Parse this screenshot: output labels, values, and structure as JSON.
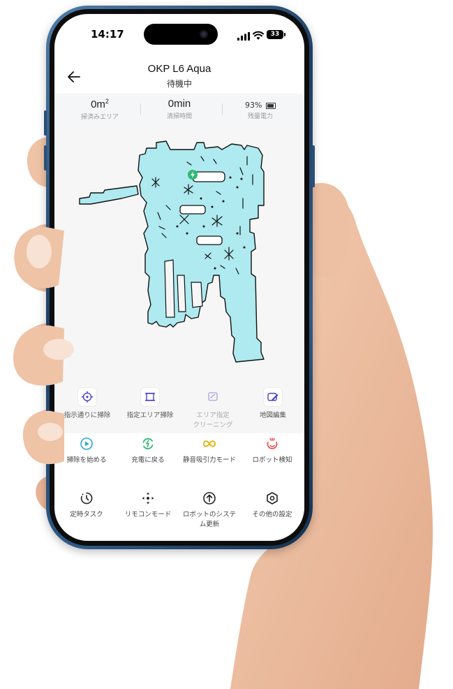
{
  "status_bar": {
    "time": "14:17",
    "battery": "33"
  },
  "header": {
    "title": "OKP L6 Aqua",
    "subtitle": "待機中"
  },
  "stats": {
    "area": {
      "value": "0m",
      "unit_sup": "2",
      "label": "掃済みエリア"
    },
    "time": {
      "value": "0min",
      "label": "清掃時間"
    },
    "battery": {
      "value": "93%",
      "label": "残量電力"
    }
  },
  "map": {
    "floor_color": "#aeeaf0",
    "wall_color": "#111111",
    "dock_color": "#2eb872"
  },
  "edit_tools": [
    {
      "label": "指示通りに掃除",
      "icon": "target-crosshair-icon",
      "enabled": true
    },
    {
      "label": "指定エリア掃除",
      "icon": "area-select-icon",
      "enabled": true
    },
    {
      "label": "エリア指定\nクリーニング",
      "icon": "area-cleaning-icon",
      "enabled": false
    },
    {
      "label": "地図編集",
      "icon": "map-edit-icon",
      "enabled": true
    }
  ],
  "actions_row1": [
    {
      "label": "掃除を始める",
      "icon": "play-circle-icon",
      "color": "#2aa7d8"
    },
    {
      "label": "充電に戻る",
      "icon": "recharge-icon",
      "color": "#2eb872"
    },
    {
      "label": "静音吸引力モード",
      "icon": "infinity-icon",
      "color": "#e2b100"
    },
    {
      "label": "ロボット検知",
      "icon": "robot-locate-icon",
      "color": "#e8463c"
    }
  ],
  "actions_row2": [
    {
      "label": "定時タスク",
      "icon": "timer-icon",
      "color": "#222222"
    },
    {
      "label": "リモコンモード",
      "icon": "remote-dpad-icon",
      "color": "#222222"
    },
    {
      "label": "ロボットのシステ\nム更新",
      "icon": "upgrade-icon",
      "color": "#222222"
    },
    {
      "label": "その他の設定",
      "icon": "settings-hex-icon",
      "color": "#222222"
    }
  ]
}
